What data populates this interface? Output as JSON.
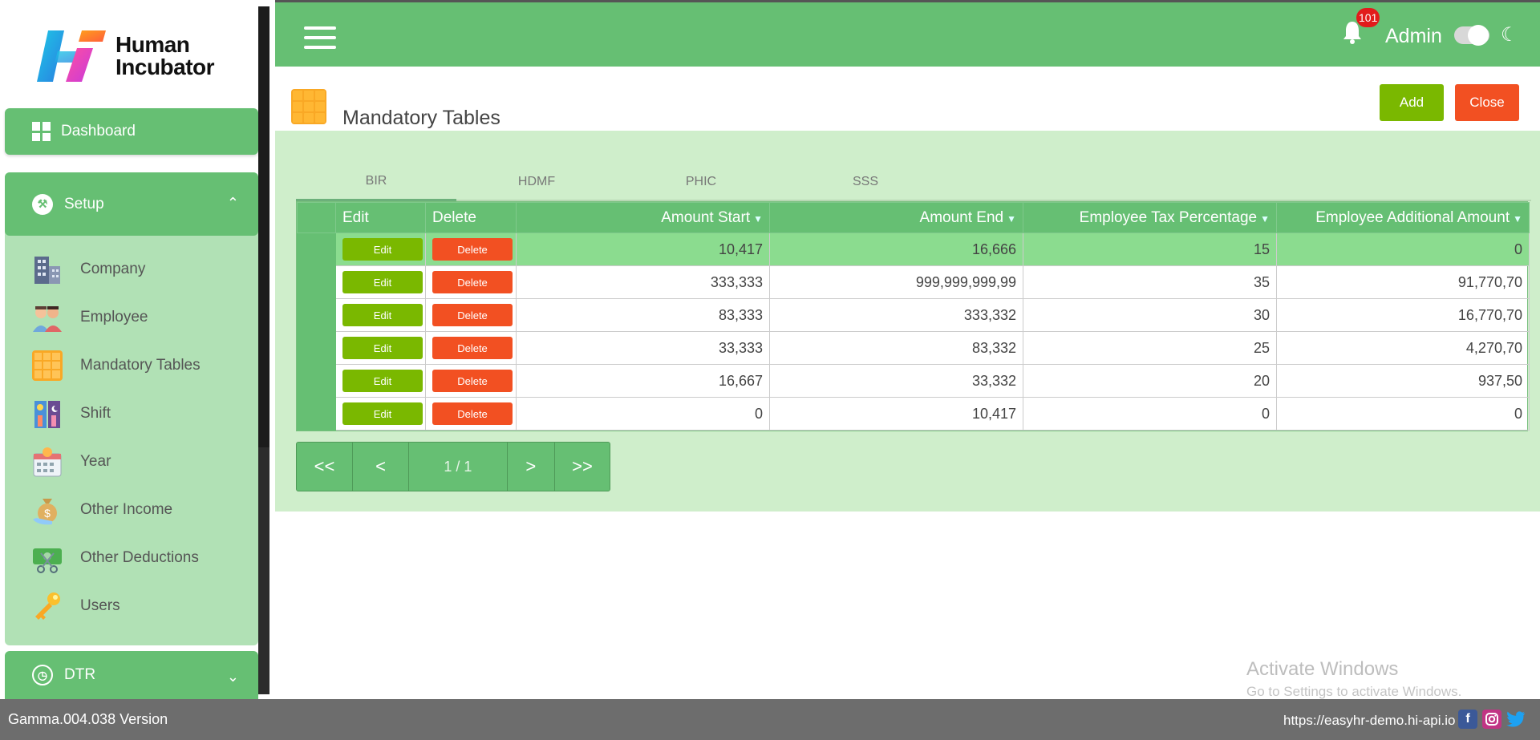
{
  "brand": {
    "line1": "Human",
    "line2": "Incubator"
  },
  "sidebar": {
    "dashboard": "Dashboard",
    "setup": "Setup",
    "setup_items": [
      {
        "label": "Company",
        "icon": "building-icon"
      },
      {
        "label": "Employee",
        "icon": "people-icon"
      },
      {
        "label": "Mandatory Tables",
        "icon": "grid-icon"
      },
      {
        "label": "Shift",
        "icon": "shift-icon"
      },
      {
        "label": "Year",
        "icon": "calendar-icon"
      },
      {
        "label": "Other Income",
        "icon": "money-bag-icon"
      },
      {
        "label": "Other Deductions",
        "icon": "scissors-money-icon"
      },
      {
        "label": "Users",
        "icon": "key-icon"
      }
    ],
    "dtr": "DTR"
  },
  "topbar": {
    "notification_count": "101",
    "user": "Admin"
  },
  "page": {
    "title": "Mandatory Tables",
    "add_label": "Add",
    "close_label": "Close"
  },
  "tabs": [
    "BIR",
    "HDMF",
    "PHIC",
    "SSS"
  ],
  "active_tab": "BIR",
  "table": {
    "columns": [
      "Edit",
      "Delete",
      "Amount Start",
      "Amount End",
      "Employee Tax Percentage",
      "Employee Additional Amount"
    ],
    "edit_label": "Edit",
    "delete_label": "Delete",
    "rows": [
      [
        "10,417",
        "16,666",
        "15",
        "0"
      ],
      [
        "333,333",
        "999,999,999,99",
        "35",
        "91,770,70"
      ],
      [
        "83,333",
        "333,332",
        "30",
        "16,770,70"
      ],
      [
        "33,333",
        "83,332",
        "25",
        "4,270,70"
      ],
      [
        "16,667",
        "33,332",
        "20",
        "937,50"
      ],
      [
        "0",
        "10,417",
        "0",
        "0"
      ]
    ]
  },
  "pager": {
    "first": "<<",
    "prev": "<",
    "info": "1 / 1",
    "next": ">",
    "last": ">>"
  },
  "watermark": {
    "title": "Activate Windows",
    "subtitle": "Go to Settings to activate Windows."
  },
  "footer": {
    "version": "Gamma.004.038 Version",
    "url": "https://easyhr-demo.hi-api.io"
  },
  "colors": {
    "primary_green": "#66bf73",
    "light_green": "#cfeecb",
    "add_green": "#7ab800",
    "danger": "#f25022"
  }
}
